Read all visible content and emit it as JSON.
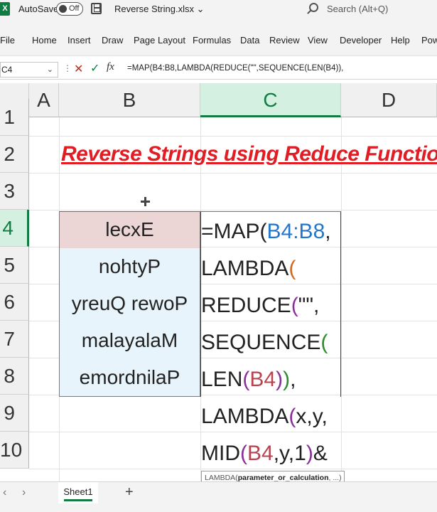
{
  "titlebar": {
    "app_logo": "X",
    "autosave_label": "AutoSave",
    "autosave_state": "Off",
    "save_icon": "save-icon",
    "filename": "Reverse String.xlsx",
    "filename_chevron": "⌄",
    "search_placeholder": "Search (Alt+Q)"
  },
  "ribbon": {
    "tabs": [
      "File",
      "Home",
      "Insert",
      "Draw",
      "Page Layout",
      "Formulas",
      "Data",
      "Review",
      "View",
      "Developer",
      "Help",
      "Pow"
    ]
  },
  "formula_bar": {
    "name_box": "C4",
    "name_box_chevron": "⌄",
    "dots": "⋮",
    "cancel_glyph": "✕",
    "enter_glyph": "✓",
    "fx_label": "fx",
    "formula": "=MAP(B4:B8,LAMBDA(REDUCE(\"\",SEQUENCE(LEN(B4)),"
  },
  "grid": {
    "columns": [
      "A",
      "B",
      "C",
      "D"
    ],
    "active_column": "C",
    "rows": [
      "1",
      "2",
      "3",
      "4",
      "5",
      "6",
      "7",
      "8",
      "9",
      "10"
    ],
    "active_row": "4",
    "title": "Reverse Strings using Reduce Function",
    "b_values": [
      "lecxE",
      "nohtyP",
      "yreuQ rewoP",
      "malayalaM",
      "emordnilaP"
    ]
  },
  "formula_lines": [
    [
      {
        "t": "=MAP(",
        "c": "fn-dark"
      },
      {
        "t": "B4:B8",
        "c": "ref-blue"
      },
      {
        "t": ",",
        "c": "fn-dark"
      }
    ],
    [
      {
        "t": "LAMBDA",
        "c": "fn-dark"
      },
      {
        "t": "(",
        "c": "paren-orange"
      }
    ],
    [
      {
        "t": "REDUCE",
        "c": "fn-dark"
      },
      {
        "t": "(",
        "c": "paren-purple"
      },
      {
        "t": "\"\",",
        "c": "fn-dark"
      }
    ],
    [
      {
        "t": "SEQUENCE",
        "c": "fn-dark"
      },
      {
        "t": "(",
        "c": "paren-green"
      }
    ],
    [
      {
        "t": "LEN",
        "c": "fn-dark"
      },
      {
        "t": "(",
        "c": "paren-purple"
      },
      {
        "t": "B4",
        "c": "ref-red"
      },
      {
        "t": ")",
        "c": "paren-purple"
      },
      {
        "t": ")",
        "c": "paren-green"
      },
      {
        "t": ",",
        "c": "fn-dark"
      }
    ],
    [
      {
        "t": "LAMBDA",
        "c": "fn-dark"
      },
      {
        "t": "(",
        "c": "paren-purple"
      },
      {
        "t": "x,y,",
        "c": "fn-dark"
      }
    ],
    [
      {
        "t": "MID",
        "c": "fn-dark"
      },
      {
        "t": "(",
        "c": "paren-purple"
      },
      {
        "t": "B4",
        "c": "ref-red"
      },
      {
        "t": ",y,1",
        "c": "fn-dark"
      },
      {
        "t": ")",
        "c": "paren-purple"
      },
      {
        "t": "&",
        "c": "fn-dark"
      }
    ]
  ],
  "tooltip": {
    "fn": "LAMBDA(",
    "args": "parameter_or_calculation",
    "tail": ", ...)"
  },
  "sheets": {
    "prev_glyph": "‹",
    "next_glyph": "›",
    "active": "Sheet1",
    "add_glyph": "+"
  },
  "colors": {
    "excel_green": "#107c41",
    "title_red": "#e31b23",
    "ref_blue": "#2277cc",
    "ref_red": "#b8434f"
  }
}
